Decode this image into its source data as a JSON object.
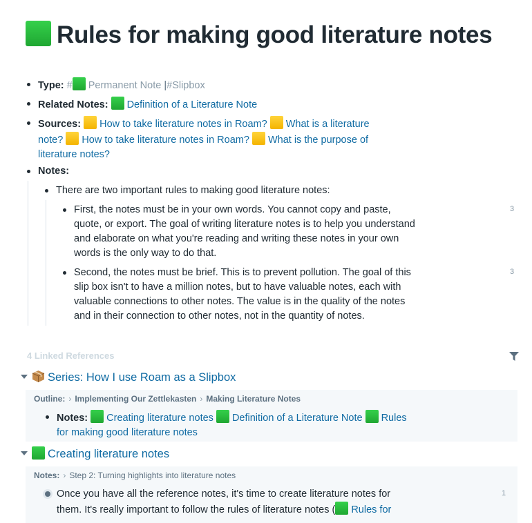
{
  "title": "Rules for making good literature notes",
  "type_row": {
    "label": "Type:",
    "hash": "#",
    "tag1": "Permanent Note",
    "sep": "|",
    "tag2": "#Slipbox"
  },
  "related_row": {
    "label": "Related Notes:",
    "link": "Definition of a Literature Note"
  },
  "sources_row": {
    "label": "Sources:",
    "link1": "How to take literature notes in Roam?",
    "link2a": "What is a literature",
    "link2b": "note?",
    "link3": "How to take literature notes in Roam?",
    "link4a": "What is the purpose of",
    "link4b": "literature notes?"
  },
  "notes_row": {
    "label": "Notes:"
  },
  "notes": {
    "intro": "There are two important rules to making good literature notes:",
    "rule1": [
      "First, the notes must be in your own words. You cannot copy and paste,",
      "quote, or export. The goal of writing literature notes is to help you understand",
      "and elaborate on what you're reading and writing these notes in your own",
      "words is the only way to do that."
    ],
    "rule1_count": "3",
    "rule2": [
      "Second, the notes must be brief. This is to prevent pollution. The goal of this",
      "slip box isn't to have a million notes, but to have valuable notes, each with",
      "valuable connections to other notes. The value is in the quality of the notes",
      "and in their connection to other notes, not in the quantity of notes."
    ],
    "rule2_count": "3"
  },
  "linked_refs": {
    "header": "4 Linked References",
    "group1": {
      "title": "Series: How I use Roam as a Slipbox",
      "crumb_label": "Outline:",
      "crumb1": "Implementing Our Zettlekasten",
      "crumb2": "Making Literature Notes",
      "notes_label": "Notes:",
      "link1": "Creating literature notes",
      "link2": "Definition of a Literature Note",
      "link3a": "Rules",
      "link3b": "for making good literature notes"
    },
    "group2": {
      "title": "Creating literature notes",
      "crumb_label": "Notes:",
      "crumb1": "Step 2: Turning highlights into literature notes",
      "line1": "Once you have all the reference notes, it's time to create literature notes for",
      "line2": "them. It's really important to follow the rules of literature notes (",
      "line2_link": "Rules for",
      "count": "1"
    }
  },
  "colors": {
    "link": "#106ba3",
    "text": "#202b33",
    "muted": "#8a9ba8",
    "green_square": "#27c93f",
    "yellow_square": "#fcc419"
  },
  "icons": [
    "green-square-icon",
    "yellow-square-icon",
    "package-icon",
    "filter-icon",
    "caret-down-icon",
    "radio-bullet-icon"
  ]
}
